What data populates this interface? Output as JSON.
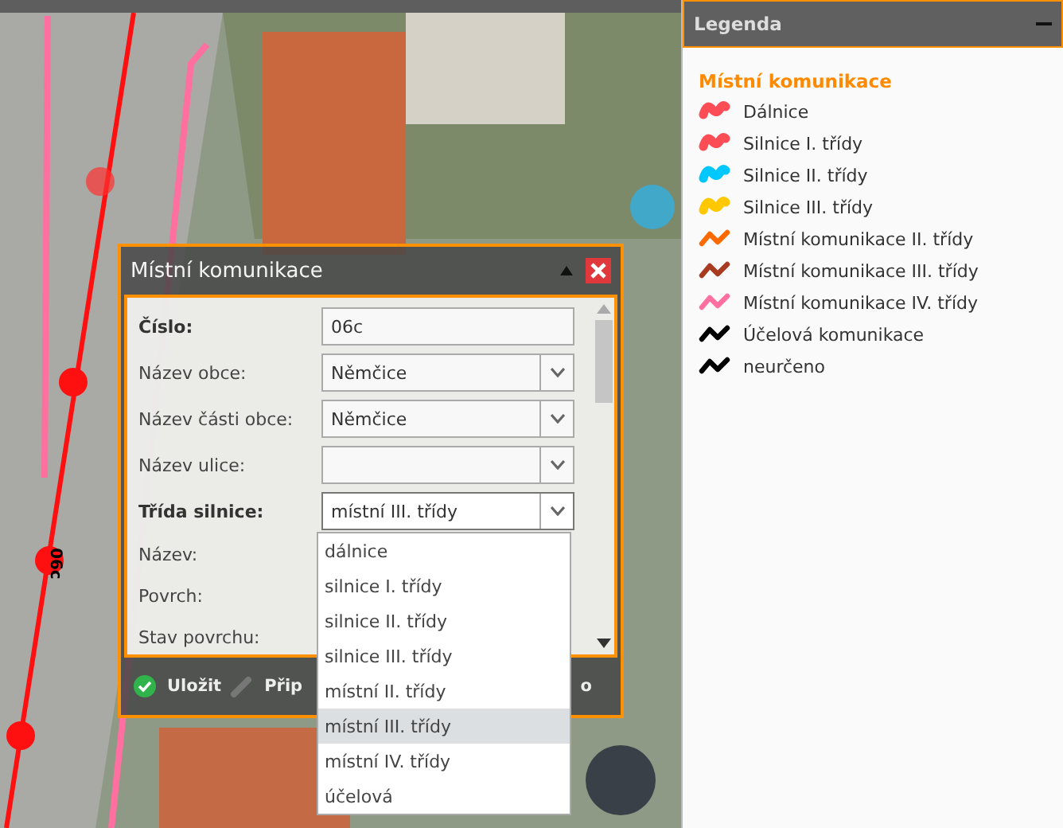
{
  "map": {
    "road_label": "06c"
  },
  "dialog": {
    "title": "Místní komunikace",
    "fields": [
      {
        "label": "Číslo:",
        "required": true,
        "kind": "text",
        "value": "06c"
      },
      {
        "label": "Název obce:",
        "required": false,
        "kind": "select",
        "value": "Němčice"
      },
      {
        "label": "Název části obce:",
        "required": false,
        "kind": "select",
        "value": "Němčice"
      },
      {
        "label": "Název ulice:",
        "required": false,
        "kind": "select"
      },
      {
        "label": "Třída silnice:",
        "required": true,
        "kind": "select",
        "value": "místní III. třídy",
        "expanded": true
      },
      {
        "label": "Název:",
        "required": false,
        "kind": "covered"
      },
      {
        "label": "Povrch:",
        "required": false,
        "kind": "covered"
      },
      {
        "label": "Stav povrchu:",
        "required": false,
        "kind": "covered"
      }
    ],
    "options": [
      {
        "label": "dálnice",
        "selected": false
      },
      {
        "label": "silnice I. třídy",
        "selected": false
      },
      {
        "label": "silnice II. třídy",
        "selected": false
      },
      {
        "label": "silnice III. třídy",
        "selected": false
      },
      {
        "label": "místní II. třídy",
        "selected": false
      },
      {
        "label": "místní III. třídy",
        "selected": true
      },
      {
        "label": "místní IV. třídy",
        "selected": false
      },
      {
        "label": "účelová",
        "selected": false
      }
    ],
    "footer": [
      {
        "kind": "save",
        "label": "Uložit"
      },
      {
        "kind": "edit",
        "label": "Přip"
      },
      {
        "kind": "plain",
        "label": "o"
      }
    ]
  },
  "legend": {
    "title": "Legenda",
    "group": "Místní komunikace",
    "items": [
      {
        "label": "Dálnice",
        "color": "#ff4d55",
        "kind": "thick"
      },
      {
        "label": "Silnice I. třídy",
        "color": "#ff4d55",
        "kind": "thick"
      },
      {
        "label": "Silnice II. třídy",
        "color": "#00c8ff",
        "kind": "thick"
      },
      {
        "label": "Silnice III. třídy",
        "color": "#ffc800",
        "kind": "thick"
      },
      {
        "label": "Místní komunikace II. třídy",
        "color": "#ff6a00",
        "kind": "thin"
      },
      {
        "label": "Místní komunikace III. třídy",
        "color": "#a83a20",
        "kind": "thin"
      },
      {
        "label": "Místní komunikace IV. třídy",
        "color": "#ff6fa0",
        "kind": "thin"
      },
      {
        "label": "Účelová komunikace",
        "color": "#000000",
        "kind": "thin"
      },
      {
        "label": "neurčeno",
        "color": "#000000",
        "kind": "thin"
      }
    ]
  }
}
